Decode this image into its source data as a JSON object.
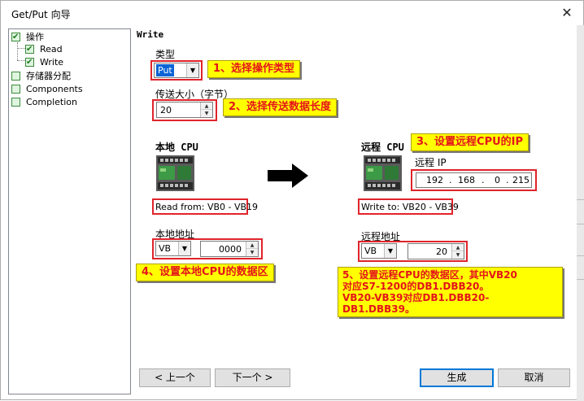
{
  "window": {
    "title": "Get/Put 向导",
    "close_glyph": "✕"
  },
  "tree": {
    "items": [
      {
        "label": "操作",
        "checked": true
      },
      {
        "label": "Read",
        "checked": true
      },
      {
        "label": "Write",
        "checked": true
      },
      {
        "label": "存储器分配",
        "checked": false
      },
      {
        "label": "Components",
        "checked": false
      },
      {
        "label": "Completion",
        "checked": false
      }
    ]
  },
  "main": {
    "section_title": "Write",
    "type": {
      "label": "类型",
      "value": "Put"
    },
    "size": {
      "label": "传送大小（字节）",
      "value": "20"
    },
    "local_cpu": {
      "title": "本地 CPU",
      "range": "Read from: VB0 - VB19",
      "addr_label": "本地地址",
      "area": "VB",
      "offset": "0000"
    },
    "remote_cpu": {
      "title": "远程 CPU",
      "ip_label": "远程 IP",
      "ip": [
        "192",
        "168",
        "0",
        "215"
      ],
      "range": "Write to: VB20 - VB39",
      "addr_label": "远程地址",
      "area": "VB",
      "offset": "20"
    }
  },
  "callouts": {
    "c1": "1、选择操作类型",
    "c2": "2、选择传送数据长度",
    "c3": "3、设置远程CPU的IP",
    "c4": "4、设置本地CPU的数据区",
    "c5_line1": "5、设置远程CPU的数据区，其中VB20",
    "c5_line2": "对应S7-1200的DB1.DBB20。",
    "c5_line3": "VB20-VB39对应DB1.DBB20-DB1.DBB39。"
  },
  "buttons": {
    "prev": "< 上一个",
    "next": "下一个 >",
    "finish": "生成",
    "cancel": "取消"
  },
  "colors": {
    "callout_bg": "#ffff00",
    "callout_text": "#e4141b",
    "highlight_border": "#e0242b",
    "accent": "#0078d7"
  },
  "icons": {
    "plc": "plc-cpu-icon",
    "arrow": "right-arrow-icon",
    "check": "check-icon"
  }
}
